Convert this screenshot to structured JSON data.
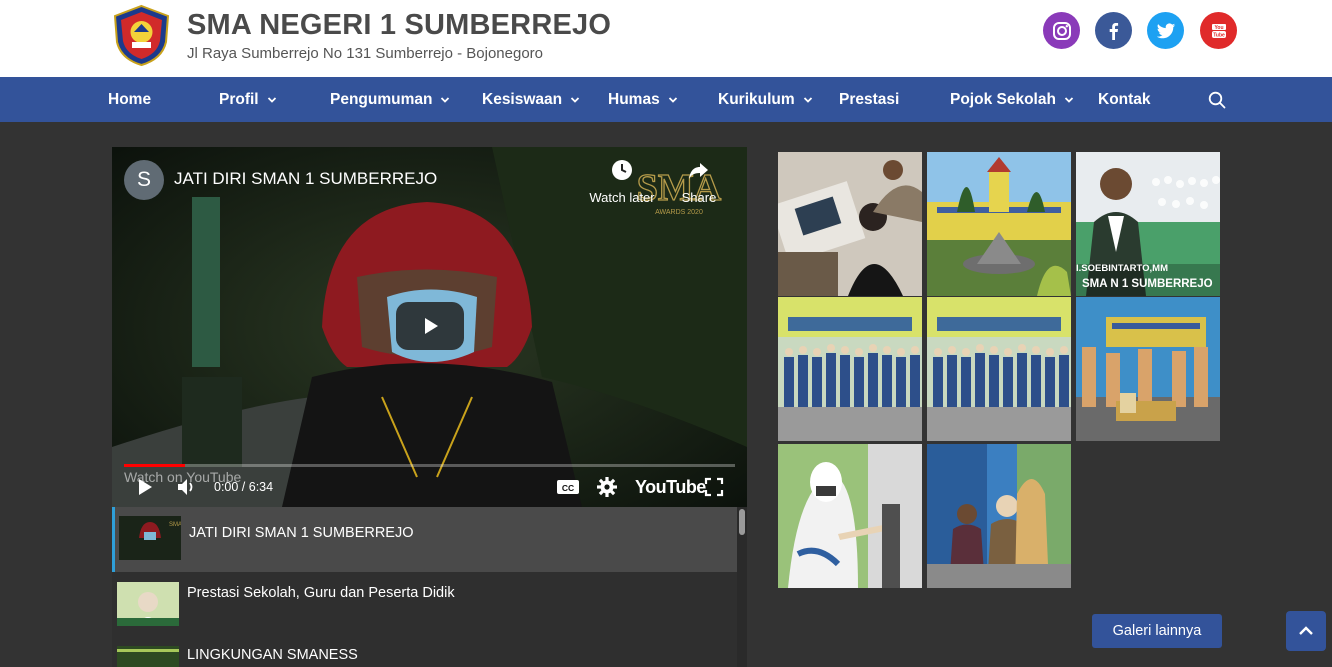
{
  "header": {
    "title": "SMA NEGERI 1 SUMBERREJO",
    "address": "Jl Raya Sumberrejo No 131 Sumberrejo - Bojonegoro",
    "social": [
      {
        "name": "instagram-icon",
        "color": "#8a3ab9"
      },
      {
        "name": "facebook-icon",
        "color": "#3b5998"
      },
      {
        "name": "twitter-icon",
        "color": "#1da1f2"
      },
      {
        "name": "youtube-icon",
        "color": "#e02a2a"
      }
    ]
  },
  "nav": {
    "items": [
      {
        "label": "Home",
        "dropdown": false
      },
      {
        "label": "Profil",
        "dropdown": true
      },
      {
        "label": "Pengumuman",
        "dropdown": true
      },
      {
        "label": "Kesiswaan",
        "dropdown": true
      },
      {
        "label": "Humas",
        "dropdown": true
      },
      {
        "label": "Kurikulum",
        "dropdown": true
      },
      {
        "label": "Prestasi",
        "dropdown": false
      },
      {
        "label": "Pojok Sekolah",
        "dropdown": true
      },
      {
        "label": "Kontak",
        "dropdown": false
      }
    ],
    "color": "#33539a"
  },
  "video": {
    "channel_initial": "S",
    "title": "JATI DIRI SMAN 1 SUMBERREJO",
    "watch_later": "Watch later",
    "share": "Share",
    "watch_on": "Watch on",
    "youtube_small": "YouTube",
    "time": "0:00 / 6:34",
    "brand": "YouTube",
    "progress": 0.1
  },
  "playlist": {
    "items": [
      {
        "title": "JATI DIRI SMAN 1 SUMBERREJO",
        "active": true
      },
      {
        "title": "Prestasi Sekolah, Guru dan Peserta Didik",
        "active": false
      },
      {
        "title": "LINGKUNGAN SMANESS",
        "active": false
      }
    ]
  },
  "gallery": {
    "captions": {
      "name": "I.SOEBINTARTO,MM",
      "school": "SMA N 1 SUMBERREJO"
    },
    "more_label": "Galeri lainnya"
  }
}
